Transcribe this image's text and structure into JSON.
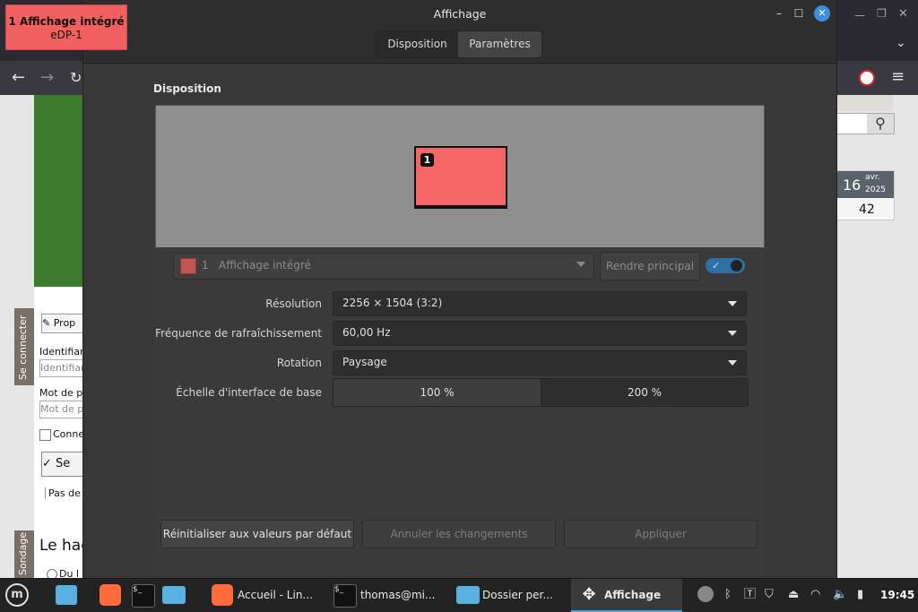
{
  "overlay": {
    "title": "1  Affichage intégré",
    "subtitle": "eDP-1"
  },
  "window": {
    "title": "Affichage",
    "minimize_icon": "minimize-icon",
    "maximize_icon": "maximize-icon",
    "close_icon": "close-icon"
  },
  "tabs": [
    {
      "label": "Disposition",
      "active": false
    },
    {
      "label": "Paramètres",
      "active": true
    }
  ],
  "section_title": "Disposition",
  "preview": {
    "monitor_number": "1",
    "monitor_color": "#f46666"
  },
  "monitor_selector": {
    "number": "1",
    "name": "Affichage intégré",
    "swatch_color": "#c55353"
  },
  "primary_button": "Rendre principal",
  "enabled_toggle": {
    "on": true
  },
  "settings": {
    "resolution": {
      "label": "Résolution",
      "value": "2256 × 1504 (3:2)"
    },
    "refresh": {
      "label": "Fréquence de rafraîchissement",
      "value": "60,00 Hz"
    },
    "rotation": {
      "label": "Rotation",
      "value": "Paysage"
    },
    "scale": {
      "label": "Échelle d'interface de base",
      "options": [
        "100 %",
        "200 %"
      ],
      "selected": "200 %"
    }
  },
  "buttons": {
    "reset": "Réinitialiser aux valeurs par défaut",
    "cancel": "Annuler les changements",
    "apply": "Appliquer"
  },
  "background": {
    "calendar": {
      "day": "16",
      "month": "avr.",
      "year": "2025",
      "number": "42"
    },
    "sidebar_tabs": [
      "Se connecter",
      "Sondage"
    ],
    "login": {
      "propose": "Prop",
      "identifier_label": "Identifian",
      "identifier_placeholder": "Identifian",
      "password_label": "Mot de pa",
      "password_placeholder": "Mot de p",
      "remember": "Conne",
      "submit": "Se",
      "no_account": "Pas de c"
    },
    "poll_heading": "Le hac",
    "poll_option": "Du l"
  },
  "taskbar": {
    "menu_icon": "mint-logo-icon",
    "items": [
      {
        "label": "Accueil - Lin...",
        "icon": "firefox-icon"
      },
      {
        "label": "thomas@mi...",
        "icon": "terminal-icon"
      },
      {
        "label": "Dossier per...",
        "icon": "folder-icon"
      },
      {
        "label": "Affichage",
        "icon": "display-move-icon",
        "active": true
      }
    ],
    "clock": "19:45"
  }
}
